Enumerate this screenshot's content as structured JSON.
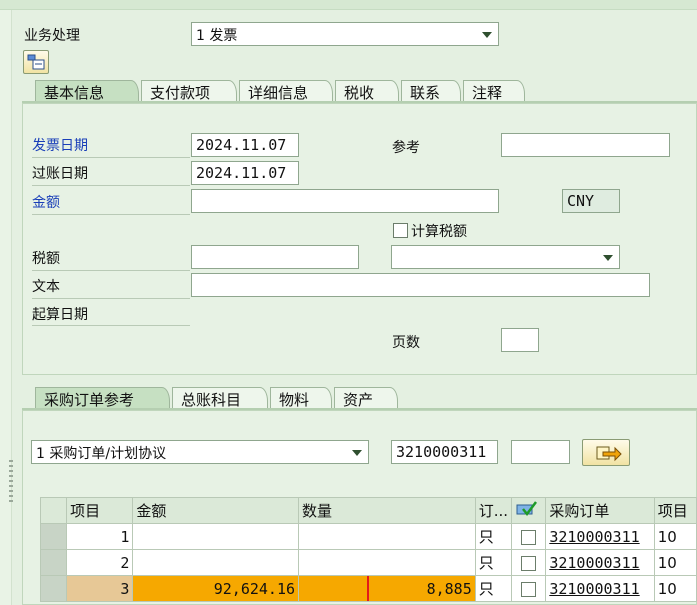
{
  "header": {
    "business_label": "业务处理",
    "business_value": "1 发票"
  },
  "tabs_top": [
    {
      "label": "基本信息",
      "active": true
    },
    {
      "label": "支付款项",
      "active": false
    },
    {
      "label": "详细信息",
      "active": false
    },
    {
      "label": "税收",
      "active": false
    },
    {
      "label": "联系",
      "active": false
    },
    {
      "label": "注释",
      "active": false
    }
  ],
  "basic": {
    "invoice_date_label": "发票日期",
    "invoice_date": "2024.11.07",
    "reference_label": "参考",
    "reference_value": "",
    "posting_date_label": "过账日期",
    "posting_date": "2024.11.07",
    "amount_label": "金额",
    "amount_value": "",
    "currency": "CNY",
    "calc_tax_label": "计算税额",
    "tax_label": "税额",
    "tax_value": "",
    "tax_code": "",
    "text_label": "文本",
    "text_value": "",
    "baseline_label": "起算日期",
    "pages_label": "页数",
    "pages_value": ""
  },
  "tabs_bottom": [
    {
      "label": "采购订单参考",
      "active": true
    },
    {
      "label": "总账科目",
      "active": false
    },
    {
      "label": "物料",
      "active": false
    },
    {
      "label": "资产",
      "active": false
    }
  ],
  "po_ref": {
    "type_value": "1 采购订单/计划协议",
    "po_number": "3210000311",
    "extra": ""
  },
  "table": {
    "headers": [
      "项目",
      "金额",
      "数量",
      "订...",
      "",
      "采购订单",
      "项目"
    ],
    "rows": [
      {
        "item": "1",
        "amount": "",
        "qty": "",
        "unit": "只",
        "po": "3210000311",
        "po_item": "10"
      },
      {
        "item": "2",
        "amount": "",
        "qty": "",
        "unit": "只",
        "po": "3210000311",
        "po_item": "10"
      },
      {
        "item": "3",
        "amount": "92,624.16",
        "qty": "8,885",
        "unit": "只",
        "po": "3210000311",
        "po_item": "10"
      }
    ]
  },
  "colors": {
    "background": "#e4f0e1",
    "highlight_row": "#f6a800",
    "label_blue": "#1a3fb8",
    "selection_box": "#e21b1b"
  }
}
